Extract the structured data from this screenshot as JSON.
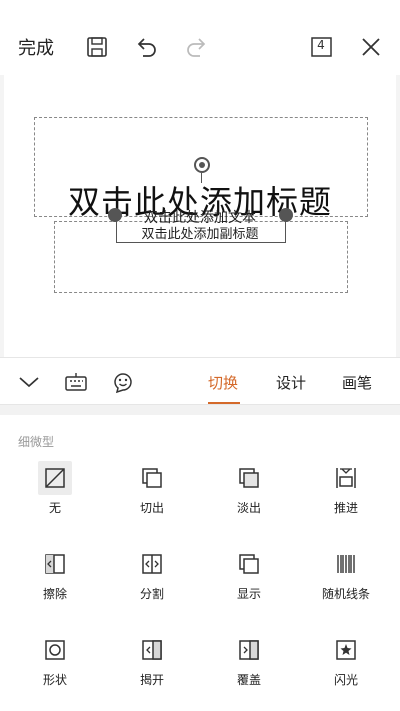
{
  "topbar": {
    "done_label": "完成",
    "page_count": "4"
  },
  "slide": {
    "title": "双击此处添加标题",
    "overlay_text": "双击此处添加文本",
    "subtitle": "双击此处添加副标题"
  },
  "tabs": {
    "transition": "切换",
    "design": "设计",
    "pen": "画笔",
    "active": "transition"
  },
  "panel": {
    "section_title": "细微型",
    "items": [
      {
        "label": "无",
        "icon": "none-icon",
        "selected": true
      },
      {
        "label": "切出",
        "icon": "cut-icon"
      },
      {
        "label": "淡出",
        "icon": "fade-icon"
      },
      {
        "label": "推进",
        "icon": "push-icon"
      },
      {
        "label": "擦除",
        "icon": "wipe-icon"
      },
      {
        "label": "分割",
        "icon": "split-icon"
      },
      {
        "label": "显示",
        "icon": "reveal-icon"
      },
      {
        "label": "随机线条",
        "icon": "random-bars-icon"
      },
      {
        "label": "形状",
        "icon": "shape-icon"
      },
      {
        "label": "揭开",
        "icon": "uncover-icon"
      },
      {
        "label": "覆盖",
        "icon": "cover-icon"
      },
      {
        "label": "闪光",
        "icon": "flash-icon"
      }
    ]
  },
  "colors": {
    "accent": "#d4692a",
    "text": "#222222",
    "muted": "#999999",
    "selection": "#555555"
  }
}
